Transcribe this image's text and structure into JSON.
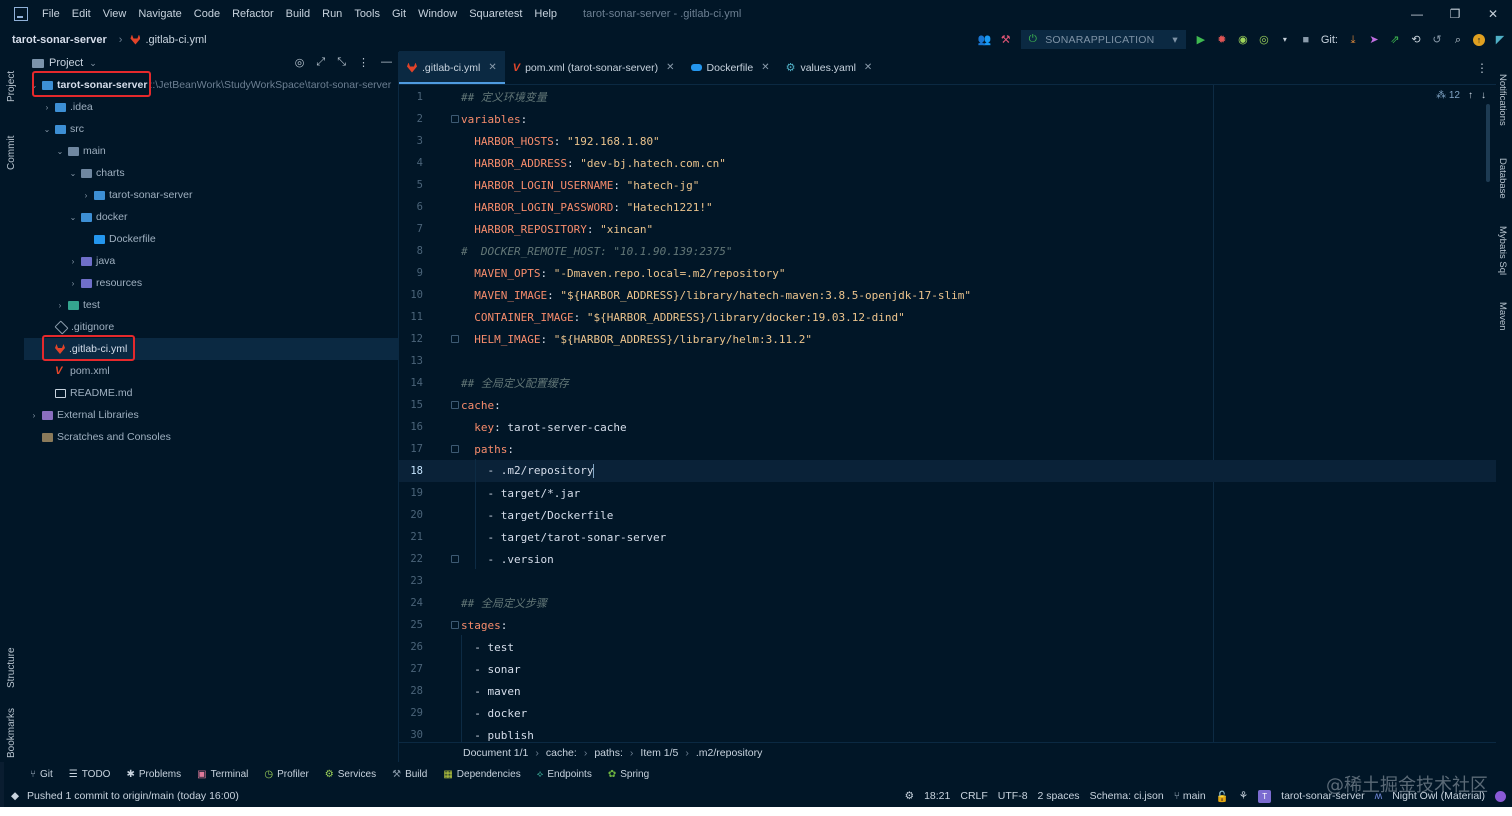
{
  "menubar": {
    "items": [
      "File",
      "Edit",
      "View",
      "Navigate",
      "Code",
      "Refactor",
      "Build",
      "Run",
      "Tools",
      "Git",
      "Window",
      "Squaretest",
      "Help"
    ],
    "window_title": "tarot-sonar-server - .gitlab-ci.yml"
  },
  "navbar": {
    "project": "tarot-sonar-server",
    "file": ".gitlab-ci.yml",
    "run_config": "SONARAPPLICATION",
    "git_label": "Git:"
  },
  "left_strip": {
    "project": "Project",
    "commit": "Commit",
    "structure": "Structure",
    "bookmarks": "Bookmarks"
  },
  "right_strip": {
    "notifications": "Notifications",
    "database": "Database",
    "mybatis": "Mybatis Sql",
    "maven": "Maven"
  },
  "project_panel": {
    "title": "Project",
    "tree": [
      {
        "label": "tarot-sonar-server",
        "path": "::\\JetBeanWork\\StudyWorkSpace\\tarot-sonar-server",
        "indent": 0,
        "arrow": "⌄",
        "icon": "folder-blue"
      },
      {
        "label": ".idea",
        "indent": 1,
        "arrow": "›",
        "icon": "folder-blue"
      },
      {
        "label": "src",
        "indent": 1,
        "arrow": "⌄",
        "icon": "folder-blue"
      },
      {
        "label": "main",
        "indent": 2,
        "arrow": "⌄",
        "icon": "folder"
      },
      {
        "label": "charts",
        "indent": 3,
        "arrow": "⌄",
        "icon": "folder"
      },
      {
        "label": "tarot-sonar-server",
        "indent": 4,
        "arrow": "›",
        "icon": "folder-blue"
      },
      {
        "label": "docker",
        "indent": 3,
        "arrow": "⌄",
        "icon": "folder-blue"
      },
      {
        "label": "Dockerfile",
        "indent": 4,
        "arrow": "",
        "icon": "docker"
      },
      {
        "label": "java",
        "indent": 3,
        "arrow": "›",
        "icon": "folder-res"
      },
      {
        "label": "resources",
        "indent": 3,
        "arrow": "›",
        "icon": "folder-res"
      },
      {
        "label": "test",
        "indent": 2,
        "arrow": "›",
        "icon": "folder-test"
      },
      {
        "label": ".gitignore",
        "indent": 1,
        "arrow": "",
        "icon": "git"
      },
      {
        "label": ".gitlab-ci.yml",
        "indent": 1,
        "arrow": "",
        "icon": "gitlab"
      },
      {
        "label": "pom.xml",
        "indent": 1,
        "arrow": "",
        "icon": "maven"
      },
      {
        "label": "README.md",
        "indent": 1,
        "arrow": "",
        "icon": "file"
      },
      {
        "label": "External Libraries",
        "indent": 0,
        "arrow": "›",
        "icon": "lib"
      },
      {
        "label": "Scratches and Consoles",
        "indent": 0,
        "arrow": "",
        "icon": "scratch"
      }
    ]
  },
  "tabs": [
    {
      "label": ".gitlab-ci.yml",
      "icon": "gitlab",
      "active": true
    },
    {
      "label": "pom.xml (tarot-sonar-server)",
      "icon": "maven",
      "active": false
    },
    {
      "label": "Dockerfile",
      "icon": "docker",
      "active": false
    },
    {
      "label": "values.yaml",
      "icon": "yaml",
      "active": false
    }
  ],
  "inspection": {
    "count": "12"
  },
  "code_lines": [
    [
      {
        "t": "## 定义环境变量",
        "c": "comment"
      }
    ],
    [
      {
        "t": "variables",
        "c": "topkey"
      },
      {
        "t": ":",
        "c": "plain"
      }
    ],
    [
      {
        "t": "  HARBOR_HOSTS",
        "c": "key"
      },
      {
        "t": ": ",
        "c": "plain"
      },
      {
        "t": "\"192.168.1.80\"",
        "c": "str"
      }
    ],
    [
      {
        "t": "  HARBOR_ADDRESS",
        "c": "key"
      },
      {
        "t": ": ",
        "c": "plain"
      },
      {
        "t": "\"dev-bj.hatech.com.cn\"",
        "c": "str"
      }
    ],
    [
      {
        "t": "  HARBOR_LOGIN_USERNAME",
        "c": "key"
      },
      {
        "t": ": ",
        "c": "plain"
      },
      {
        "t": "\"hatech-jg\"",
        "c": "str"
      }
    ],
    [
      {
        "t": "  HARBOR_LOGIN_PASSWORD",
        "c": "key"
      },
      {
        "t": ": ",
        "c": "plain"
      },
      {
        "t": "\"Hatech1221!\"",
        "c": "str"
      }
    ],
    [
      {
        "t": "  HARBOR_REPOSITORY",
        "c": "key"
      },
      {
        "t": ": ",
        "c": "plain"
      },
      {
        "t": "\"xincan\"",
        "c": "str"
      }
    ],
    [
      {
        "t": "#  DOCKER_REMOTE_HOST: \"10.1.90.139:2375\"",
        "c": "comment"
      }
    ],
    [
      {
        "t": "  MAVEN_OPTS",
        "c": "key"
      },
      {
        "t": ": ",
        "c": "plain"
      },
      {
        "t": "\"-Dmaven.repo.local=.m2/repository\"",
        "c": "str"
      }
    ],
    [
      {
        "t": "  MAVEN_IMAGE",
        "c": "key"
      },
      {
        "t": ": ",
        "c": "plain"
      },
      {
        "t": "\"${HARBOR_ADDRESS}/library/hatech-maven:3.8.5-openjdk-17-slim\"",
        "c": "str"
      }
    ],
    [
      {
        "t": "  CONTAINER_IMAGE",
        "c": "key"
      },
      {
        "t": ": ",
        "c": "plain"
      },
      {
        "t": "\"${HARBOR_ADDRESS}/library/docker:19.03.12-dind\"",
        "c": "str"
      }
    ],
    [
      {
        "t": "  HELM_IMAGE",
        "c": "key"
      },
      {
        "t": ": ",
        "c": "plain"
      },
      {
        "t": "\"${HARBOR_ADDRESS}/library/helm:3.11.2\"",
        "c": "str"
      }
    ],
    [],
    [
      {
        "t": "## 全局定义配置缓存",
        "c": "comment"
      }
    ],
    [
      {
        "t": "cache",
        "c": "topkey"
      },
      {
        "t": ":",
        "c": "plain"
      }
    ],
    [
      {
        "t": "  key",
        "c": "key"
      },
      {
        "t": ": tarot-server-cache",
        "c": "plain"
      }
    ],
    [
      {
        "t": "  paths",
        "c": "key"
      },
      {
        "t": ":",
        "c": "plain"
      }
    ],
    [
      {
        "t": "    - .m2/repository",
        "c": "plain"
      }
    ],
    [
      {
        "t": "    - target/*.jar",
        "c": "plain"
      }
    ],
    [
      {
        "t": "    - target/Dockerfile",
        "c": "plain"
      }
    ],
    [
      {
        "t": "    - target/tarot-sonar-server",
        "c": "plain"
      }
    ],
    [
      {
        "t": "    - .version",
        "c": "plain"
      }
    ],
    [],
    [
      {
        "t": "## 全局定义步骤",
        "c": "comment"
      }
    ],
    [
      {
        "t": "stages",
        "c": "topkey"
      },
      {
        "t": ":",
        "c": "plain"
      }
    ],
    [
      {
        "t": "  - test",
        "c": "plain"
      }
    ],
    [
      {
        "t": "  - sonar",
        "c": "plain"
      }
    ],
    [
      {
        "t": "  - maven",
        "c": "plain"
      }
    ],
    [
      {
        "t": "  - docker",
        "c": "plain"
      }
    ],
    [
      {
        "t": "  - publish",
        "c": "plain"
      }
    ]
  ],
  "current_line": 18,
  "breadcrumb": [
    "Document 1/1",
    "cache:",
    "paths:",
    "Item 1/5",
    ".m2/repository"
  ],
  "toolwindows": [
    "Git",
    "TODO",
    "Problems",
    "Terminal",
    "Profiler",
    "Services",
    "Build",
    "Dependencies",
    "Endpoints",
    "Spring"
  ],
  "status": {
    "message": "Pushed 1 commit to origin/main (today 16:00)",
    "position": "18:21",
    "line_sep": "CRLF",
    "encoding": "UTF-8",
    "indent": "2 spaces",
    "schema": "Schema: ci.json",
    "branch": "main",
    "project": "tarot-sonar-server",
    "theme": "Night Owl (Material)"
  },
  "watermark": "@稀土掘金技术社区"
}
